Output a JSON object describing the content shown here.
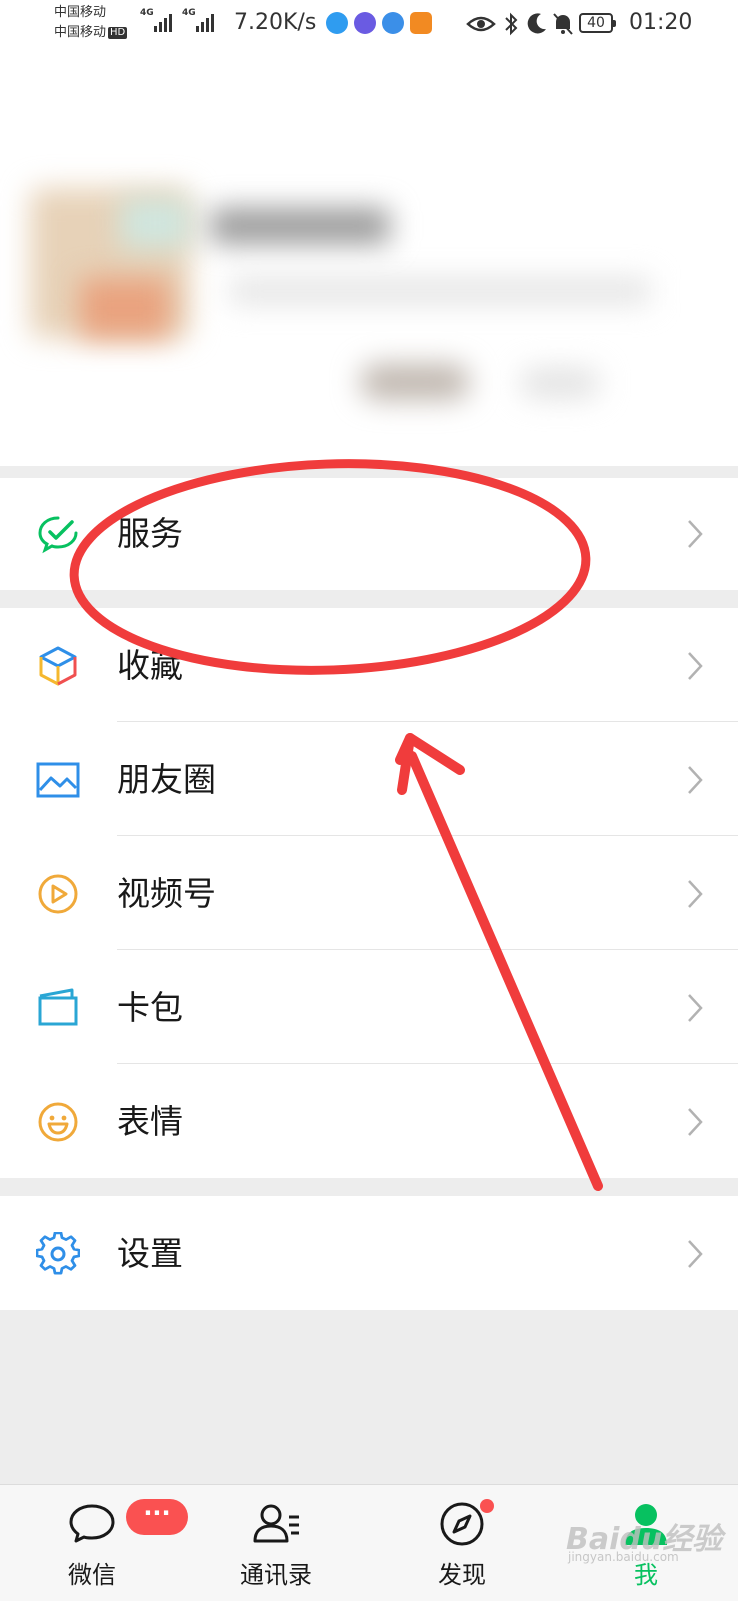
{
  "status_bar": {
    "carrier_1": "中国移动",
    "carrier_2": "中国移动",
    "hd": "HD",
    "signal_1": "4G",
    "signal_2": "4G",
    "net_speed": "7.20K/s",
    "battery": "40",
    "time": "01:20"
  },
  "menu": {
    "services": "服务",
    "favorites": "收藏",
    "moments": "朋友圈",
    "channels": "视频号",
    "card_wallet": "卡包",
    "stickers": "表情",
    "settings": "设置"
  },
  "tabs": {
    "chats": "微信",
    "chats_badge": "···",
    "contacts": "通讯录",
    "discover": "发现",
    "me": "我"
  },
  "watermark": {
    "text": "Baidu经验",
    "sub": "jingyan.baidu.com"
  },
  "colors": {
    "wechat_green": "#07c160",
    "badge_red": "#fa5151",
    "annotation_red": "#f03c3c"
  },
  "icons": {
    "services": "wechat-pay-icon",
    "favorites": "cube-icon",
    "moments": "picture-icon",
    "channels": "play-icon",
    "card_wallet": "wallet-icon",
    "stickers": "smiley-icon",
    "settings": "gear-icon"
  }
}
